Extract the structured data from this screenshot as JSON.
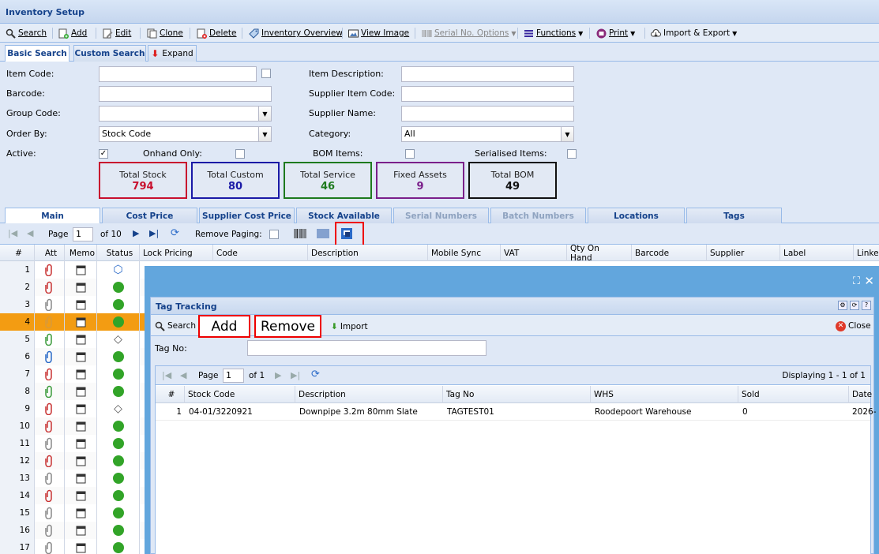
{
  "window": {
    "title": "Inventory Setup"
  },
  "toolbar": {
    "search": "Search",
    "add": "Add",
    "edit": "Edit",
    "clone": "Clone",
    "delete": "Delete",
    "inventory_overview": "Inventory Overview",
    "view_image": "View Image",
    "serial_no_options": "Serial No. Options",
    "functions": "Functions",
    "print": "Print",
    "import_export": "Import & Export"
  },
  "search_tabs": {
    "basic": "Basic Search",
    "custom": "Custom Search",
    "expand": "Expand"
  },
  "form": {
    "item_code": "Item Code:",
    "barcode": "Barcode:",
    "group_code": "Group Code:",
    "order_by": "Order By:",
    "order_by_value": "Stock Code",
    "active": "Active:",
    "onhand_only": "Onhand Only:",
    "item_description": "Item Description:",
    "supplier_item_code": "Supplier Item Code:",
    "supplier_name": "Supplier Name:",
    "category": "Category:",
    "category_value": "All",
    "bom_items": "BOM Items:",
    "serialised_items": "Serialised Items:"
  },
  "stats": [
    {
      "label": "Total Stock",
      "value": "794",
      "color": "#c8102e"
    },
    {
      "label": "Total Custom",
      "value": "80",
      "color": "#1a1aa6"
    },
    {
      "label": "Total Service",
      "value": "46",
      "color": "#1e7a1e"
    },
    {
      "label": "Fixed Assets",
      "value": "9",
      "color": "#7a1f8a"
    },
    {
      "label": "Total BOM",
      "value": "49",
      "color": "#111111"
    }
  ],
  "grid_tabs": [
    "Main",
    "Cost Price",
    "Supplier Cost Price",
    "Stock Available",
    "Serial Numbers",
    "Batch Numbers",
    "Locations",
    "Tags"
  ],
  "pager": {
    "page_label": "Page",
    "page_value": "1",
    "of_label": "of 10",
    "remove_paging": "Remove Paging:"
  },
  "grid_columns": [
    "#",
    "Att",
    "Memo",
    "Status",
    "Lock Pricing",
    "Code",
    "Description",
    "Mobile Sync",
    "VAT",
    "Qty On Hand",
    "Barcode",
    "Supplier",
    "Label",
    "Linked"
  ],
  "rows": [
    "1",
    "2",
    "3",
    "4",
    "5",
    "6",
    "7",
    "8",
    "9",
    "10",
    "11",
    "12",
    "13",
    "14",
    "15",
    "16",
    "17"
  ],
  "tag_tracking": {
    "title": "Tag Tracking",
    "search": "Search",
    "add": "Add",
    "remove": "Remove",
    "import": "Import",
    "close": "Close",
    "tag_no_label": "Tag No:",
    "page_label": "Page",
    "page_value": "1",
    "of_label": "of 1",
    "displaying": "Displaying 1 - 1 of 1",
    "columns": [
      "#",
      "Stock Code",
      "Description",
      "Tag No",
      "WHS",
      "Sold",
      "Date"
    ],
    "rows": [
      {
        "num": "1",
        "stock_code": "04-01/3220921",
        "description": "Downpipe 3.2m 80mm Slate",
        "tag_no": "TAGTEST01",
        "whs": "Roodepoort Warehouse",
        "sold": "0",
        "date": "2026-"
      }
    ]
  }
}
